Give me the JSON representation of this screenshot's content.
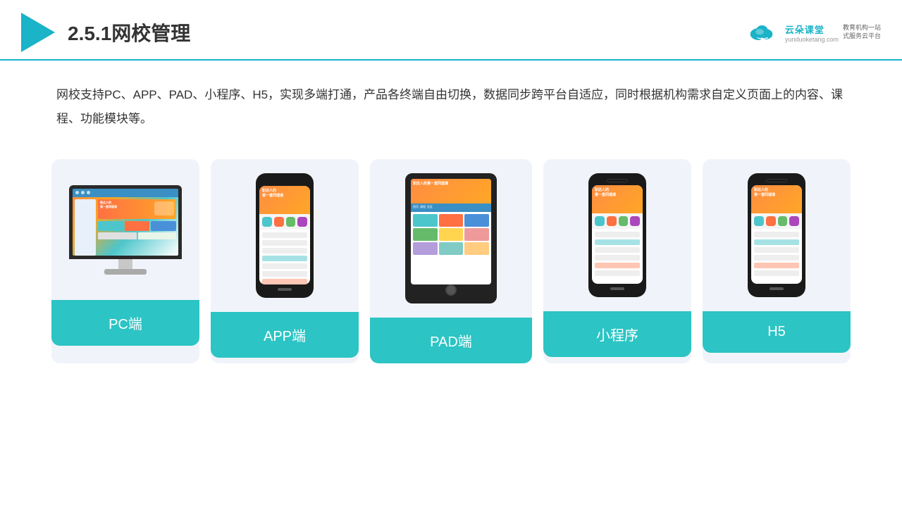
{
  "header": {
    "title": "2.5.1网校管理",
    "brand_name": "云朵课堂",
    "brand_url": "yunduoketang.com",
    "brand_tagline": "教育机构一站\n式服务云平台"
  },
  "description": {
    "text": "网校支持PC、APP、PAD、小程序、H5，实现多端打通，产品各终端自由切换，数据同步跨平台自适应，同时根据机构需求自定义页面上的内容、课程、功能模块等。"
  },
  "cards": [
    {
      "label": "PC端",
      "type": "pc"
    },
    {
      "label": "APP端",
      "type": "phone"
    },
    {
      "label": "PAD端",
      "type": "tablet"
    },
    {
      "label": "小程序",
      "type": "phone_small"
    },
    {
      "label": "H5",
      "type": "phone_h5"
    }
  ],
  "colors": {
    "accent": "#2cc4c4",
    "header_line": "#1ab3c8"
  }
}
